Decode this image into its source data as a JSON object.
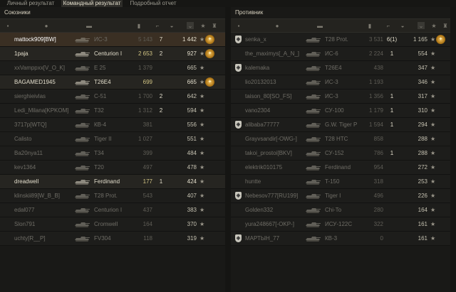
{
  "tabs": [
    {
      "label": "Личный результат",
      "active": false
    },
    {
      "label": "Командный результат",
      "active": true
    },
    {
      "label": "Подробный отчет",
      "active": false
    }
  ],
  "allies": {
    "title": "Союзники",
    "rows": [
      {
        "name": "mattock909[BW]",
        "tank": "ИС-3",
        "damage": "5 143",
        "frags": "7",
        "xp": "1 442",
        "state": "me",
        "medal": true
      },
      {
        "name": "1paja",
        "tank": "Centurion I",
        "damage": "2 653",
        "frags": "2",
        "xp": "927",
        "state": "alive",
        "medal": true
      },
      {
        "name": "xxVamppxx[V_O_K]",
        "tank": "E 25",
        "damage": "1 379",
        "frags": "",
        "xp": "665",
        "state": "dead",
        "medal": false
      },
      {
        "name": "BAGAMED1945",
        "tank": "T26E4",
        "damage": "699",
        "frags": "",
        "xp": "665",
        "state": "alive",
        "medal": true
      },
      {
        "name": "sierghieivlas",
        "tank": "C-51",
        "damage": "1 700",
        "frags": "2",
        "xp": "642",
        "state": "dead",
        "medal": false
      },
      {
        "name": "Ledi_Milana[KPKOM]",
        "tank": "T32",
        "damage": "1 312",
        "frags": "2",
        "xp": "594",
        "state": "dead",
        "medal": false
      },
      {
        "name": "3717p[WTQ]",
        "tank": "КВ-4",
        "damage": "381",
        "frags": "",
        "xp": "556",
        "state": "dead",
        "medal": false
      },
      {
        "name": "Calisto",
        "tank": "Tiger II",
        "damage": "1 027",
        "frags": "",
        "xp": "551",
        "state": "dead",
        "medal": false
      },
      {
        "name": "Ba20nya11",
        "tank": "T34",
        "damage": "399",
        "frags": "",
        "xp": "484",
        "state": "dead",
        "medal": false
      },
      {
        "name": "kev1364",
        "tank": "T20",
        "damage": "497",
        "frags": "",
        "xp": "478",
        "state": "dead",
        "medal": false
      },
      {
        "name": "dreadwell",
        "tank": "Ferdinand",
        "damage": "177",
        "frags": "1",
        "xp": "424",
        "state": "alive",
        "medal": false
      },
      {
        "name": "klinskii89[W_B_B]",
        "tank": "T28 Prot.",
        "damage": "543",
        "frags": "",
        "xp": "407",
        "state": "dead",
        "medal": false
      },
      {
        "name": "edal077",
        "tank": "Centurion I",
        "damage": "437",
        "frags": "",
        "xp": "383",
        "state": "dead",
        "medal": false
      },
      {
        "name": "Slon791",
        "tank": "Cromwell",
        "damage": "164",
        "frags": "",
        "xp": "370",
        "state": "dead",
        "medal": false
      },
      {
        "name": "uchty[R__P]",
        "tank": "FV304",
        "damage": "118",
        "frags": "",
        "xp": "319",
        "state": "dead",
        "medal": false
      }
    ]
  },
  "enemies": {
    "title": "Противник",
    "rows": [
      {
        "name": "senka_x",
        "tank": "T28 Prot.",
        "damage": "3 531",
        "frags": "6(1)",
        "xp": "1 165",
        "state": "dead",
        "medal": true,
        "clan": true
      },
      {
        "name": "the_maximys[_A_N_]",
        "tank": "ИС-6",
        "damage": "2 224",
        "frags": "1",
        "xp": "554",
        "state": "dead",
        "medal": false,
        "clan": false
      },
      {
        "name": "kalemaka",
        "tank": "T26E4",
        "damage": "438",
        "frags": "",
        "xp": "347",
        "state": "dead",
        "medal": false,
        "clan": true
      },
      {
        "name": "lio20132013",
        "tank": "ИС-3",
        "damage": "1 193",
        "frags": "",
        "xp": "346",
        "state": "dead",
        "medal": false,
        "clan": false
      },
      {
        "name": "taison_80[SO_FS]",
        "tank": "ИС-3",
        "damage": "1 356",
        "frags": "1",
        "xp": "317",
        "state": "dead",
        "medal": false,
        "clan": false
      },
      {
        "name": "vano2304",
        "tank": "СУ-100",
        "damage": "1 179",
        "frags": "1",
        "xp": "310",
        "state": "dead",
        "medal": false,
        "clan": false
      },
      {
        "name": "alibaba77777",
        "tank": "G.W. Tiger P",
        "damage": "1 594",
        "frags": "1",
        "xp": "294",
        "state": "dead",
        "medal": false,
        "clan": true
      },
      {
        "name": "Grayvsandir[-OWG-]",
        "tank": "T28 HTC",
        "damage": "858",
        "frags": "",
        "xp": "288",
        "state": "dead",
        "medal": false,
        "clan": false
      },
      {
        "name": "takoi_prostoi[BKV]",
        "tank": "СУ-152",
        "damage": "786",
        "frags": "1",
        "xp": "288",
        "state": "dead",
        "medal": false,
        "clan": false
      },
      {
        "name": "elektrik010175",
        "tank": "Ferdinand",
        "damage": "954",
        "frags": "",
        "xp": "272",
        "state": "dead",
        "medal": false,
        "clan": false
      },
      {
        "name": "huntte",
        "tank": "T-150",
        "damage": "318",
        "frags": "",
        "xp": "253",
        "state": "dead",
        "medal": false,
        "clan": false
      },
      {
        "name": "Nebesov777[RU199]",
        "tank": "Tiger I",
        "damage": "496",
        "frags": "",
        "xp": "226",
        "state": "dead",
        "medal": false,
        "clan": true
      },
      {
        "name": "Golden332",
        "tank": "Chi-To",
        "damage": "280",
        "frags": "",
        "xp": "164",
        "state": "dead",
        "medal": false,
        "clan": false
      },
      {
        "name": "yura248667[-OKP-]",
        "tank": "ИСУ-122С",
        "damage": "322",
        "frags": "",
        "xp": "161",
        "state": "dead",
        "medal": false,
        "clan": false
      },
      {
        "name": "МАРТЫН_77",
        "tank": "КВ-3",
        "damage": "0",
        "frags": "",
        "xp": "161",
        "state": "dead",
        "medal": false,
        "clan": true
      }
    ]
  },
  "icons": {
    "header": [
      "squad-icon",
      "player-icon",
      "tank-icon",
      "damage-icon",
      "frags-icon",
      "spotted-icon",
      "sort-arrow-icon",
      "xp-star-icon",
      "medal-icon"
    ],
    "row": [
      "xp-star-icon",
      "medal-icon",
      "clan-shield-icon",
      "tank-silhouette-icon"
    ]
  },
  "colors": {
    "accent_gold": "#d0c383",
    "alive_text": "#e2ddcb",
    "dead_text": "#6f6d66",
    "me_row": "#3a2f23"
  }
}
